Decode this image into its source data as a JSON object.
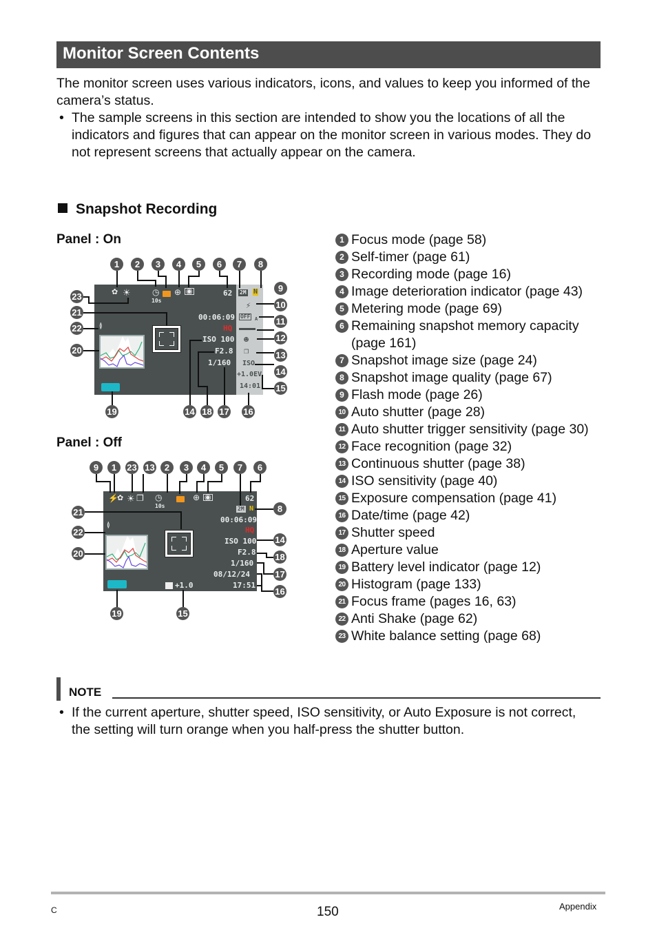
{
  "header": {
    "title": "Monitor Screen Contents"
  },
  "intro": "The monitor screen uses various indicators, icons, and values to keep you informed of the camera’s status.",
  "intro_bullet": "The sample screens in this section are intended to show you the locations of all the indicators and figures that can appear on the monitor screen in various modes. They do not represent screens that actually appear on the camera.",
  "bullet_glyph": "•",
  "section": {
    "title": "Snapshot Recording"
  },
  "panel_on": {
    "label": "Panel : On",
    "screen": {
      "remaining": "62",
      "self_timer": "10s",
      "movie_time": "00:06:09",
      "quality": "HQ",
      "iso": "ISO 100",
      "aperture": "F2.8",
      "shutter": "1/160",
      "size": "2M",
      "quality_tag": "N",
      "auto_shutter": "OFF",
      "auto_shutter_sub": "A",
      "iso_strip": "ISO",
      "ev": "+1.0EV",
      "time": "14:01"
    },
    "callouts_top": [
      "1",
      "2",
      "3",
      "4",
      "5",
      "6",
      "7",
      "8"
    ],
    "callouts_right": [
      "9",
      "10",
      "11",
      "12",
      "13",
      "14",
      "15"
    ],
    "callouts_left": [
      "23",
      "21",
      "22",
      "20"
    ],
    "callouts_bottom": [
      "19",
      "14",
      "18",
      "17",
      "16"
    ]
  },
  "panel_off": {
    "label": "Panel : Off",
    "screen": {
      "remaining": "62",
      "self_timer": "10s",
      "size": "2M",
      "quality_tag": "N",
      "movie_time": "00:06:09",
      "quality": "HQ",
      "iso": "ISO 100",
      "aperture": "F2.8",
      "shutter": "1/160",
      "date": "08/12/24",
      "time": "17:51",
      "ev": "+1.0"
    },
    "callouts_top": [
      "9",
      "1",
      "23",
      "13",
      "2",
      "3",
      "4",
      "5",
      "7",
      "6"
    ],
    "callouts_right": [
      "8",
      "14",
      "18",
      "17",
      "16"
    ],
    "callouts_left": [
      "21",
      "22",
      "20"
    ],
    "callouts_bottom": [
      "19",
      "15"
    ]
  },
  "legend": [
    {
      "num": "1",
      "text": "Focus mode (page 58)"
    },
    {
      "num": "2",
      "text": "Self-timer (page 61)"
    },
    {
      "num": "3",
      "text": "Recording mode (page 16)"
    },
    {
      "num": "4",
      "text": "Image deterioration indicator (page 43)"
    },
    {
      "num": "5",
      "text": "Metering mode (page 69)"
    },
    {
      "num": "6",
      "text": "Remaining snapshot memory capacity (page 161)"
    },
    {
      "num": "7",
      "text": "Snapshot image size (page 24)"
    },
    {
      "num": "8",
      "text": "Snapshot image quality (page 67)"
    },
    {
      "num": "9",
      "text": "Flash mode (page 26)"
    },
    {
      "num": "10",
      "text": "Auto shutter (page 28)"
    },
    {
      "num": "11",
      "text": "Auto shutter trigger sensitivity (page 30)"
    },
    {
      "num": "12",
      "text": "Face recognition (page 32)"
    },
    {
      "num": "13",
      "text": "Continuous shutter (page 38)"
    },
    {
      "num": "14",
      "text": "ISO sensitivity (page 40)"
    },
    {
      "num": "15",
      "text": "Exposure compensation (page 41)"
    },
    {
      "num": "16",
      "text": "Date/time (page 42)"
    },
    {
      "num": "17",
      "text": "Shutter speed"
    },
    {
      "num": "18",
      "text": "Aperture value"
    },
    {
      "num": "19",
      "text": "Battery level indicator (page 12)"
    },
    {
      "num": "20",
      "text": "Histogram (page 133)"
    },
    {
      "num": "21",
      "text": "Focus frame (pages 16, 63)"
    },
    {
      "num": "22",
      "text": "Anti Shake (page 62)"
    },
    {
      "num": "23",
      "text": "White balance setting (page 68)"
    }
  ],
  "note": {
    "label": "NOTE",
    "bullet": "If the current aperture, shutter speed, ISO sensitivity, or Auto Exposure is not correct, the setting will turn orange when you half-press the shutter button."
  },
  "footer": {
    "left": "C",
    "page": "150",
    "right": "Appendix"
  },
  "colors": {
    "title_bar": "#4d4d4d",
    "screen_bg": "#4a5050",
    "recording_mode": "#f0961e",
    "hq": "#e02b2b",
    "quality_tag": "#e8c000",
    "battery": "#1cb8c8",
    "callout": "#555555"
  }
}
